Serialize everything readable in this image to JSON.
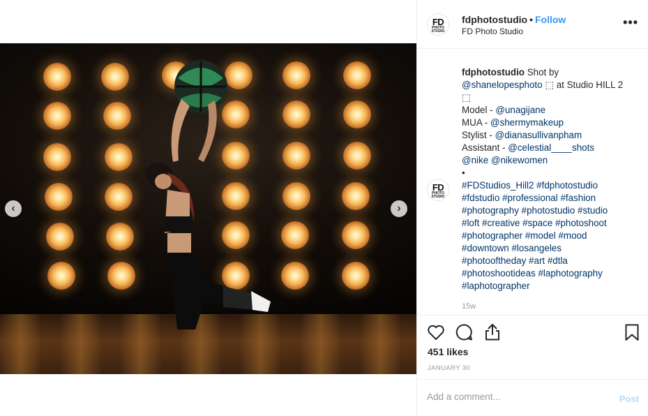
{
  "post": {
    "username": "fdphotostudio",
    "follow_label": "Follow",
    "location": "FD Photo Studio",
    "avatar_text": "FD",
    "avatar_subtext": "PHOTO STUDIO",
    "more_label": "•••"
  },
  "media": {
    "prev_label": "‹",
    "next_label": "›"
  },
  "caption": {
    "username": "fdphotostudio",
    "lines": [
      {
        "pre": "Shot by",
        "tag": ""
      },
      {
        "pre": "",
        "tag": "@shanelopesphoto",
        "post": " ⬚ at Studio HILL 2"
      },
      {
        "pre": "⬚",
        "tag": ""
      },
      {
        "pre": "Model - ",
        "tag": "@unagijane"
      },
      {
        "pre": "MUA - ",
        "tag": "@shermymakeup"
      },
      {
        "pre": "Stylist - ",
        "tag": "@dianasullivanpham"
      },
      {
        "pre": "Assistant - ",
        "tag": "@celestial____shots"
      },
      {
        "pre": "",
        "tag": "@nike @nikewomen"
      },
      {
        "pre": "•",
        "tag": ""
      },
      {
        "pre": "",
        "tag": "#FDStudios_Hill2 #fdphotostudio"
      },
      {
        "pre": "",
        "tag": "#fdstudio #professional #fashion"
      },
      {
        "pre": "",
        "tag": "#photography #photostudio #studio"
      },
      {
        "pre": "",
        "tag": "#loft #creative #space #photoshoot"
      },
      {
        "pre": "",
        "tag": "#photographer #model #mood"
      },
      {
        "pre": "",
        "tag": "#downtown #losangeles"
      },
      {
        "pre": "",
        "tag": "#photooftheday #art #dtla"
      },
      {
        "pre": "",
        "tag": "#photoshootideas #laphotography"
      },
      {
        "pre": "",
        "tag": "#laphotographer"
      }
    ],
    "age": "15w"
  },
  "icons": {
    "like": "heart-icon",
    "comment": "comment-icon",
    "share": "share-icon",
    "save": "bookmark-icon"
  },
  "stats": {
    "likes": "451 likes",
    "date": "JANUARY 30"
  },
  "comment": {
    "placeholder": "Add a comment...",
    "post_label": "Post"
  },
  "colors": {
    "link": "#003569",
    "follow": "#3897f0",
    "post_disabled": "#b3dbff"
  }
}
